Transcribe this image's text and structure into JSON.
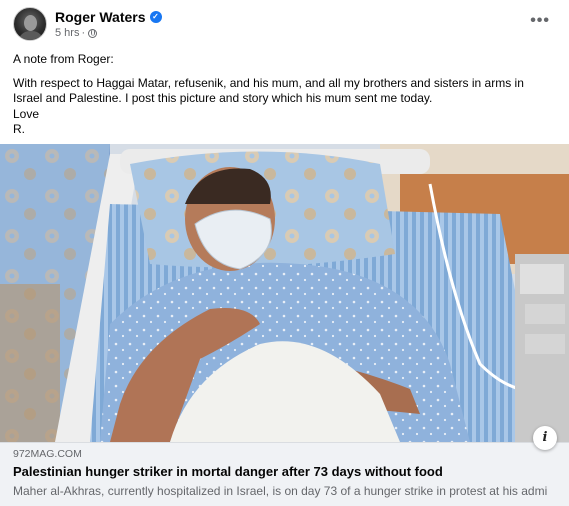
{
  "post": {
    "author": "Roger Waters",
    "time": "5 hrs",
    "separator": "·",
    "verified_icon": "verified-badge-icon",
    "privacy_icon": "globe-icon",
    "more_icon": "more-options-icon",
    "more_glyph": "•••",
    "verified_glyph": "✓",
    "text_lines": [
      "A note from Roger:",
      "With respect to Haggai Matar, refusenik, and his mum, and all my brothers and sisters in arms in",
      "Israel and Palestine. I post this picture and story which his mum sent me today.",
      "Love",
      "R."
    ]
  },
  "link_preview": {
    "domain": "972MAG.COM",
    "headline": "Palestinian hunger striker in mortal danger after 73 days without food",
    "description": "Maher al-Akhras, currently hospitalized in Israel, is on day 73 of a hunger strike in protest at his admi",
    "info_glyph": "i",
    "info_icon": "info-icon"
  },
  "colors": {
    "verified": "#1877f2",
    "secondary_text": "#65676b",
    "preview_background": "#f0f2f5"
  }
}
